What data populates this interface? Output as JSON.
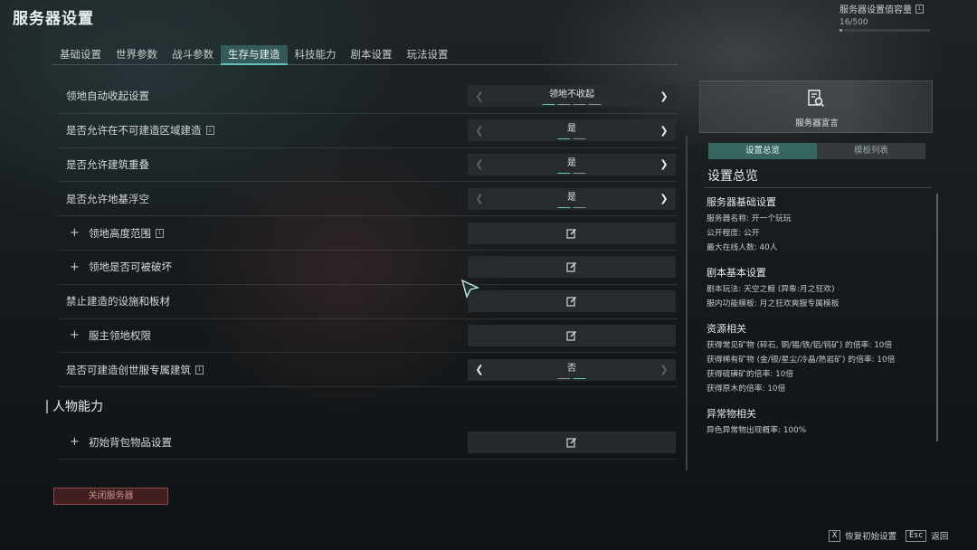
{
  "header": {
    "title": "服务器设置",
    "capacity_label": "服务器设置值容量",
    "capacity_count": "16/500",
    "capacity_progress": 0.032
  },
  "tabs": [
    {
      "label": "基础设置",
      "active": false
    },
    {
      "label": "世界参数",
      "active": false
    },
    {
      "label": "战斗参数",
      "active": false
    },
    {
      "label": "生存与建造",
      "active": true
    },
    {
      "label": "科技能力",
      "active": false
    },
    {
      "label": "剧本设置",
      "active": false
    },
    {
      "label": "玩法设置",
      "active": false
    }
  ],
  "settings": {
    "territory_auto_collect": {
      "label": "领地自动收起设置",
      "value": "领地不收起"
    },
    "build_restricted_area": {
      "label": "是否允许在不可建造区域建造",
      "value": "是"
    },
    "building_overlap": {
      "label": "是否允许建筑重叠",
      "value": "是"
    },
    "foundation_float": {
      "label": "是否允许地基浮空",
      "value": "是"
    },
    "territory_height": {
      "label": "领地高度范围"
    },
    "territory_destructible": {
      "label": "领地是否可被破坏"
    },
    "banned_facilities": {
      "label": "禁止建造的设施和板材"
    },
    "owner_territory_permission": {
      "label": "服主领地权限"
    },
    "genesis_buildings": {
      "label": "是否可建造创世服专属建筑",
      "value": "否"
    }
  },
  "section_character": {
    "title": "人物能力",
    "initial_backpack": {
      "label": "初始背包物品设置"
    }
  },
  "bottom": {
    "close_server": "关闭服务器",
    "restore_key": "X",
    "restore_label": "恢复初始设置",
    "back_key": "Esc",
    "back_label": "返回"
  },
  "panel": {
    "banner_label": "服务器宣言",
    "tabs": [
      {
        "label": "设置总览",
        "active": true
      },
      {
        "label": "模板列表",
        "active": false
      }
    ],
    "overview_title": "设置总览",
    "groups": [
      {
        "title": "服务器基础设置",
        "lines": [
          "服务器名称: 开一个玩玩",
          "公开程度: 公开",
          "最大在线人数: 40人"
        ]
      },
      {
        "title": "剧本基本设置",
        "lines": [
          "剧本玩法: 天空之鲸 (异象:月之狂欢)",
          "服内功能模板: 月之狂欢爽服专属模板"
        ]
      },
      {
        "title": "资源相关",
        "lines": [
          "获得常见矿物 (碎石, 铜/锡/铁/铝/钨矿) 的倍率: 10倍",
          "获得稀有矿物 (金/银/星尘/冷晶/熱岩矿) 的倍率: 10倍",
          "获得硫磺矿的倍率: 10倍",
          "获得原木的倍率: 10倍"
        ]
      },
      {
        "title": "异常物相关",
        "lines": [
          "异色异常物出现概率: 100%"
        ]
      }
    ]
  },
  "colors": {
    "accent": "#5fc7c0",
    "danger": "#8a4a48"
  }
}
